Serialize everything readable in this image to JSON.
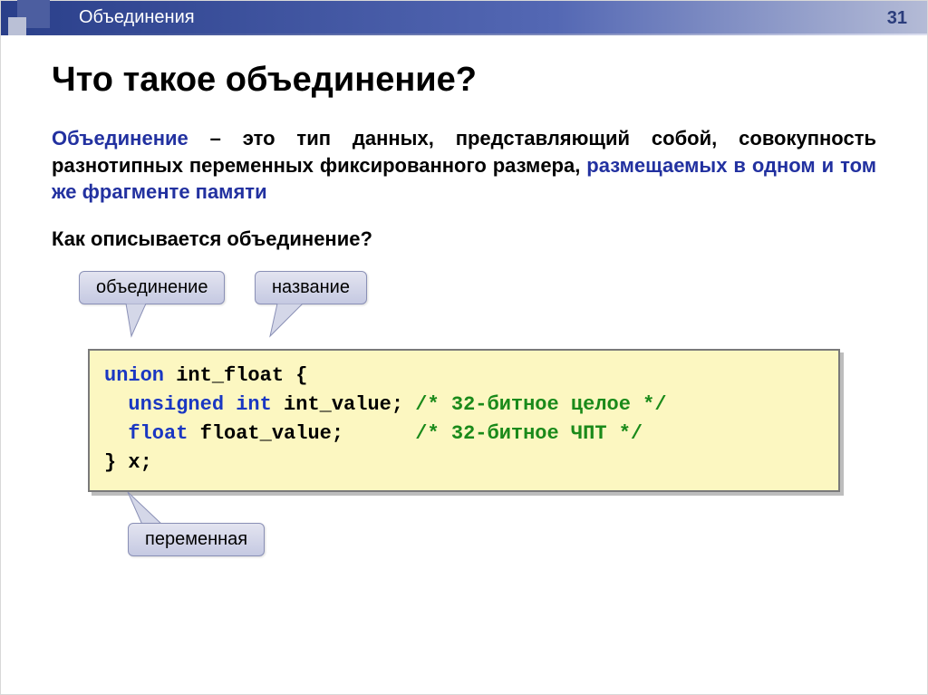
{
  "header": {
    "section_title": "Объединения",
    "page_number": "31"
  },
  "title": "Что такое объединение?",
  "definition": {
    "term": "Объединение",
    "body": " – это тип данных, представляющий собой, совокупность разнотипных переменных фиксированного размера, ",
    "highlight": "размещаемых в одном и том же фрагменте памяти"
  },
  "sub_question": "Как описывается объединение?",
  "callouts": {
    "union_label": "объединение",
    "name_label": "название",
    "var_label": "переменная"
  },
  "code": {
    "line1_kw": "union",
    "line1_rest": " int_float {",
    "line2_kw": "unsigned int",
    "line2_rest": " int_value; ",
    "line2_cmt": "/* 32-битное целое */",
    "line3_kw": "float",
    "line3_rest": " float_value;",
    "line3_pad": "      ",
    "line3_cmt": "/* 32-битное ЧПТ */",
    "line4": "} x;"
  }
}
